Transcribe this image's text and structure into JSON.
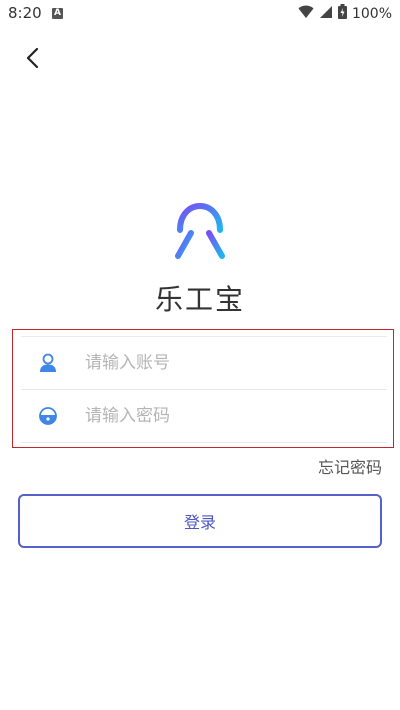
{
  "status_bar": {
    "time": "8:20",
    "notification_glyph": "A",
    "battery": "100%"
  },
  "app": {
    "title": "乐工宝"
  },
  "form": {
    "account_placeholder": "请输入账号",
    "password_placeholder": "请输入密码"
  },
  "links": {
    "forgot_password": "忘记密码"
  },
  "actions": {
    "login_label": "登录"
  },
  "colors": {
    "accent": "#5561c8",
    "highlight_border": "#c0262b",
    "logo_start": "#7b4df2",
    "logo_end": "#1fb6f0"
  },
  "icons": [
    "back-arrow-icon",
    "user-icon",
    "lock-icon",
    "wifi-icon",
    "signal-icon",
    "battery-icon"
  ]
}
